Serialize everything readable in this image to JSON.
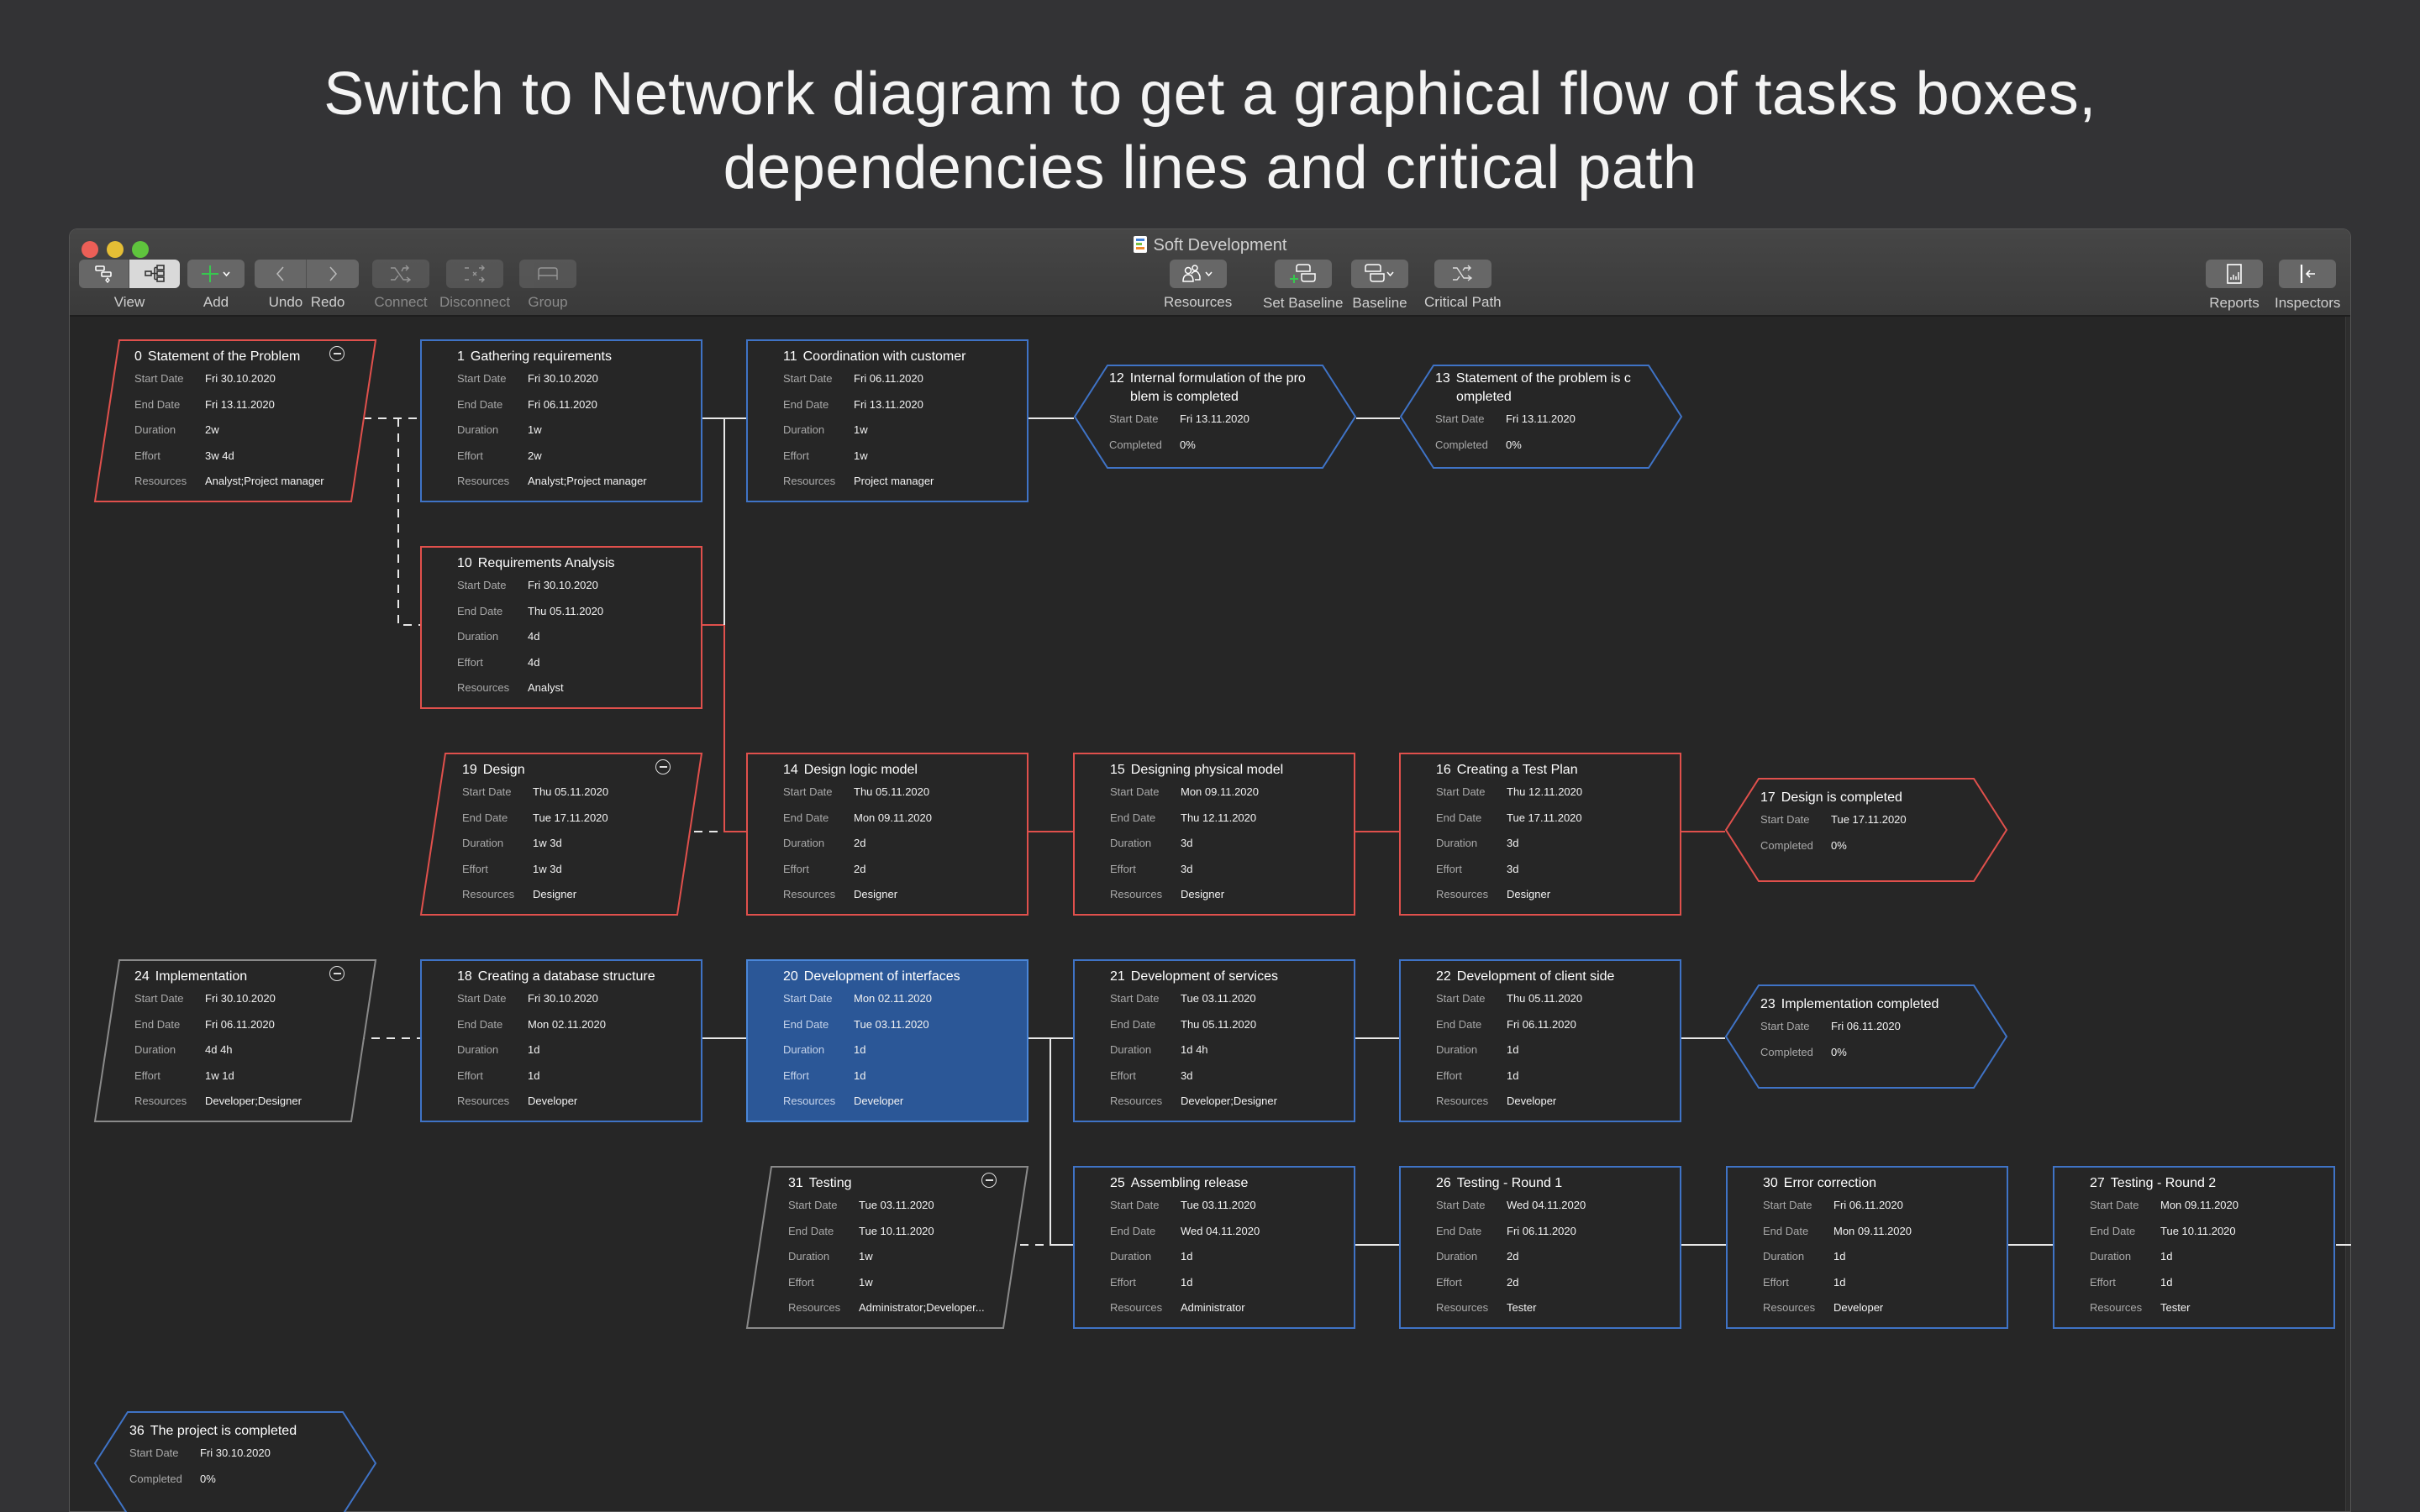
{
  "headline": {
    "line1": "Switch to Network diagram to get a graphical flow of tasks boxes,",
    "line2": "dependencies lines and critical path"
  },
  "window": {
    "title": "Soft Development",
    "title_icon": "gantt-document-icon"
  },
  "toolbar": {
    "view_label": "View",
    "add_label": "Add",
    "undo_label": "Undo",
    "redo_label": "Redo",
    "connect_label": "Connect",
    "disconnect_label": "Disconnect",
    "group_label": "Group",
    "resources_label": "Resources",
    "set_baseline_label": "Set Baseline",
    "baseline_label": "Baseline",
    "critical_path_label": "Critical Path",
    "reports_label": "Reports",
    "inspectors_label": "Inspectors",
    "active_view": "network-diagram"
  },
  "colors": {
    "critical": "#e0504c",
    "normal": "#3f73c6",
    "summary": "#8a8a8a",
    "selected_fill": "#2b5797",
    "link": "#e8e8e8"
  },
  "labels": {
    "start": "Start Date",
    "end": "End Date",
    "duration": "Duration",
    "effort": "Effort",
    "resources": "Resources",
    "completed": "Completed"
  },
  "nodes": [
    {
      "id": "0",
      "name": "Statement of the Problem",
      "kind": "summary",
      "status": "critical",
      "start": "Fri 30.10.2020",
      "end": "Fri 13.11.2020",
      "duration": "2w",
      "effort": "3w 4d",
      "resources": "Analyst;Project manager"
    },
    {
      "id": "1",
      "name": "Gathering requirements",
      "kind": "task",
      "status": "normal",
      "start": "Fri 30.10.2020",
      "end": "Fri 06.11.2020",
      "duration": "1w",
      "effort": "2w",
      "resources": "Analyst;Project manager"
    },
    {
      "id": "11",
      "name": "Coordination with customer",
      "kind": "task",
      "status": "normal",
      "start": "Fri 06.11.2020",
      "end": "Fri 13.11.2020",
      "duration": "1w",
      "effort": "1w",
      "resources": "Project manager"
    },
    {
      "id": "12",
      "name": "Internal formulation of the pro",
      "name2": "blem is completed",
      "kind": "milestone",
      "status": "normal",
      "start": "Fri 13.11.2020",
      "completed": "0%"
    },
    {
      "id": "13",
      "name": "Statement of the problem is c",
      "name2": "ompleted",
      "kind": "milestone",
      "status": "normal",
      "start": "Fri 13.11.2020",
      "completed": "0%"
    },
    {
      "id": "10",
      "name": "Requirements Analysis",
      "kind": "task",
      "status": "critical",
      "start": "Fri 30.10.2020",
      "end": "Thu 05.11.2020",
      "duration": "4d",
      "effort": "4d",
      "resources": "Analyst"
    },
    {
      "id": "19",
      "name": "Design",
      "kind": "summary",
      "status": "critical",
      "start": "Thu 05.11.2020",
      "end": "Tue 17.11.2020",
      "duration": "1w 3d",
      "effort": "1w 3d",
      "resources": "Designer"
    },
    {
      "id": "14",
      "name": "Design logic model",
      "kind": "task",
      "status": "critical",
      "start": "Thu 05.11.2020",
      "end": "Mon 09.11.2020",
      "duration": "2d",
      "effort": "2d",
      "resources": "Designer"
    },
    {
      "id": "15",
      "name": "Designing physical model",
      "kind": "task",
      "status": "critical",
      "start": "Mon 09.11.2020",
      "end": "Thu 12.11.2020",
      "duration": "3d",
      "effort": "3d",
      "resources": "Designer"
    },
    {
      "id": "16",
      "name": "Creating a Test Plan",
      "kind": "task",
      "status": "critical",
      "start": "Thu 12.11.2020",
      "end": "Tue 17.11.2020",
      "duration": "3d",
      "effort": "3d",
      "resources": "Designer"
    },
    {
      "id": "17",
      "name": "Design is completed",
      "kind": "milestone",
      "status": "critical",
      "start": "Tue 17.11.2020",
      "completed": "0%"
    },
    {
      "id": "24",
      "name": "Implementation",
      "kind": "summary",
      "status": "summary",
      "start": "Fri 30.10.2020",
      "end": "Fri 06.11.2020",
      "duration": "4d 4h",
      "effort": "1w 1d",
      "resources": "Developer;Designer"
    },
    {
      "id": "18",
      "name": "Creating a database structure",
      "kind": "task",
      "status": "normal",
      "start": "Fri 30.10.2020",
      "end": "Mon 02.11.2020",
      "duration": "1d",
      "effort": "1d",
      "resources": "Developer"
    },
    {
      "id": "20",
      "name": "Development of interfaces",
      "kind": "task",
      "status": "selected",
      "start": "Mon 02.11.2020",
      "end": "Tue 03.11.2020",
      "duration": "1d",
      "effort": "1d",
      "resources": "Developer"
    },
    {
      "id": "21",
      "name": "Development of services",
      "kind": "task",
      "status": "normal",
      "start": "Tue 03.11.2020",
      "end": "Thu 05.11.2020",
      "duration": "1d 4h",
      "effort": "3d",
      "resources": "Developer;Designer"
    },
    {
      "id": "22",
      "name": "Development of client side",
      "kind": "task",
      "status": "normal",
      "start": "Thu 05.11.2020",
      "end": "Fri 06.11.2020",
      "duration": "1d",
      "effort": "1d",
      "resources": "Developer"
    },
    {
      "id": "23",
      "name": "Implementation completed",
      "kind": "milestone",
      "status": "normal",
      "start": "Fri 06.11.2020",
      "completed": "0%"
    },
    {
      "id": "31",
      "name": "Testing",
      "kind": "summary",
      "status": "summary",
      "start": "Tue 03.11.2020",
      "end": "Tue 10.11.2020",
      "duration": "1w",
      "effort": "1w",
      "resources": "Administrator;Developer..."
    },
    {
      "id": "25",
      "name": "Assembling release",
      "kind": "task",
      "status": "normal",
      "start": "Tue 03.11.2020",
      "end": "Wed 04.11.2020",
      "duration": "1d",
      "effort": "1d",
      "resources": "Administrator"
    },
    {
      "id": "26",
      "name": "Testing - Round 1",
      "kind": "task",
      "status": "normal",
      "start": "Wed 04.11.2020",
      "end": "Fri 06.11.2020",
      "duration": "2d",
      "effort": "2d",
      "resources": "Tester"
    },
    {
      "id": "30",
      "name": "Error correction",
      "kind": "task",
      "status": "normal",
      "start": "Fri 06.11.2020",
      "end": "Mon 09.11.2020",
      "duration": "1d",
      "effort": "1d",
      "resources": "Developer"
    },
    {
      "id": "27",
      "name": "Testing - Round 2",
      "kind": "task",
      "status": "normal",
      "start": "Mon 09.11.2020",
      "end": "Tue 10.11.2020",
      "duration": "1d",
      "effort": "1d",
      "resources": "Tester"
    },
    {
      "id": "36",
      "name": "The project is completed",
      "kind": "milestone",
      "status": "normal",
      "start": "Fri 30.10.2020",
      "completed": "0%"
    }
  ],
  "links": [
    {
      "from": "0",
      "to": "1",
      "type": "summary"
    },
    {
      "from": "0",
      "to": "10",
      "type": "summary"
    },
    {
      "from": "1",
      "to": "11",
      "type": "normal"
    },
    {
      "from": "11",
      "to": "12",
      "type": "normal"
    },
    {
      "from": "12",
      "to": "13",
      "type": "normal"
    },
    {
      "from": "10",
      "to": "14",
      "type": "critical"
    },
    {
      "from": "19",
      "to": "14",
      "type": "summary"
    },
    {
      "from": "14",
      "to": "15",
      "type": "critical"
    },
    {
      "from": "15",
      "to": "16",
      "type": "critical"
    },
    {
      "from": "16",
      "to": "17",
      "type": "critical"
    },
    {
      "from": "24",
      "to": "18",
      "type": "summary"
    },
    {
      "from": "18",
      "to": "20",
      "type": "normal"
    },
    {
      "from": "20",
      "to": "21",
      "type": "normal"
    },
    {
      "from": "20",
      "to": "25",
      "type": "normal"
    },
    {
      "from": "21",
      "to": "22",
      "type": "normal"
    },
    {
      "from": "22",
      "to": "23",
      "type": "normal"
    },
    {
      "from": "31",
      "to": "25",
      "type": "summary"
    },
    {
      "from": "25",
      "to": "26",
      "type": "normal"
    },
    {
      "from": "26",
      "to": "30",
      "type": "normal"
    },
    {
      "from": "30",
      "to": "27",
      "type": "normal"
    }
  ]
}
